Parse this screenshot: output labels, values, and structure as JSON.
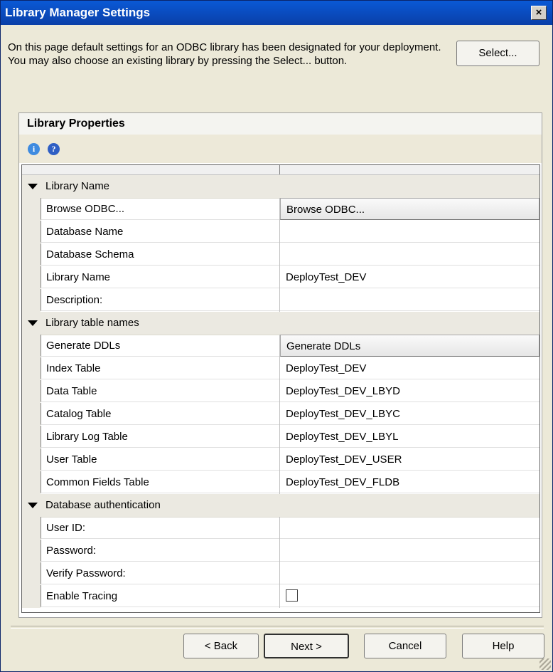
{
  "window": {
    "title": "Library Manager Settings",
    "close_label": "×"
  },
  "intro_text": "On this page default settings for an ODBC library has been designated for your deployment.  You may also choose an existing library by pressing the Select... button.",
  "select_button": "Select...",
  "panel": {
    "title": "Library Properties",
    "toolbar_icons": [
      "info-icon",
      "help-icon"
    ],
    "info_glyph": "i",
    "help_glyph": "?"
  },
  "grid": {
    "categories": [
      {
        "label": "Library Name",
        "rows": [
          {
            "name": "Browse ODBC...",
            "value": "Browse ODBC...",
            "type": "button"
          },
          {
            "name": "Database Name",
            "value": ""
          },
          {
            "name": "Database Schema",
            "value": ""
          },
          {
            "name": "Library Name",
            "value": "DeployTest_DEV"
          },
          {
            "name": "Description:",
            "value": ""
          }
        ]
      },
      {
        "label": "Library table names",
        "rows": [
          {
            "name": "Generate DDLs",
            "value": "Generate DDLs",
            "type": "button"
          },
          {
            "name": "Index Table",
            "value": "DeployTest_DEV"
          },
          {
            "name": "Data Table",
            "value": "DeployTest_DEV_LBYD"
          },
          {
            "name": "Catalog Table",
            "value": "DeployTest_DEV_LBYC"
          },
          {
            "name": "Library Log Table",
            "value": "DeployTest_DEV_LBYL"
          },
          {
            "name": "User Table",
            "value": "DeployTest_DEV_USER"
          },
          {
            "name": "Common Fields Table",
            "value": "DeployTest_DEV_FLDB"
          }
        ]
      },
      {
        "label": "Database authentication",
        "rows": [
          {
            "name": "User ID:",
            "value": ""
          },
          {
            "name": "Password:",
            "value": ""
          },
          {
            "name": "Verify Password:",
            "value": ""
          },
          {
            "name": "Enable Tracing",
            "value": "",
            "type": "checkbox",
            "checked": false
          }
        ]
      }
    ]
  },
  "footer": {
    "back": "< Back",
    "next": "Next >",
    "cancel": "Cancel",
    "help": "Help"
  }
}
